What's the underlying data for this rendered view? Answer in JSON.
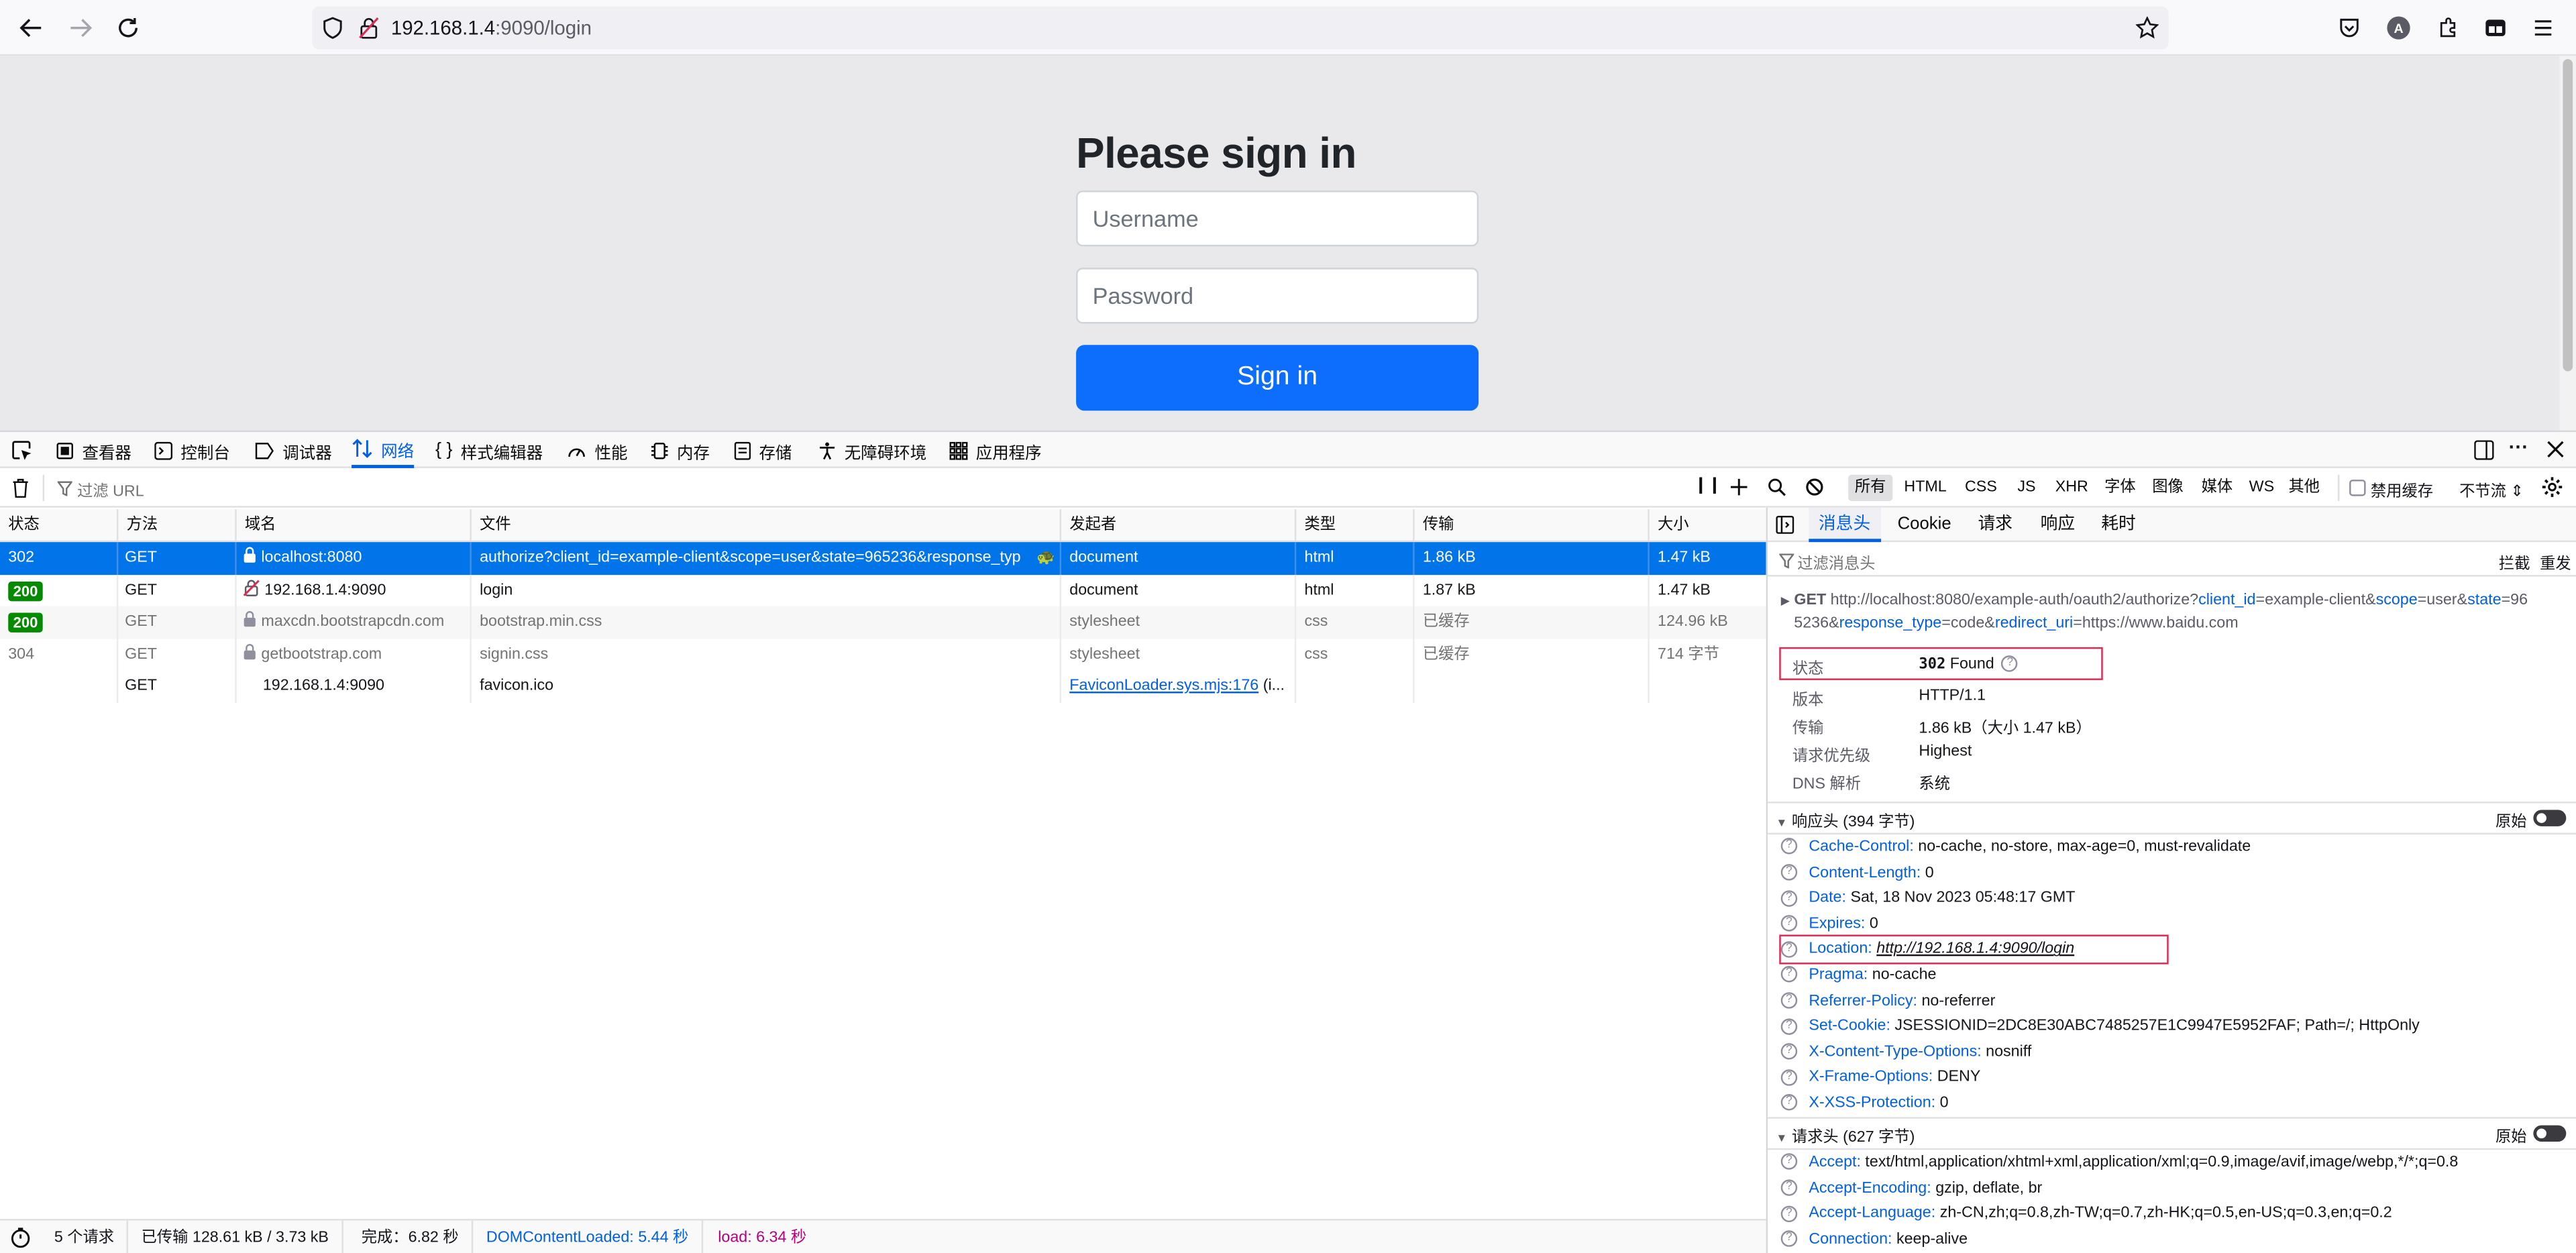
{
  "browser": {
    "url_host": "192.168.1.4",
    "url_rest": ":9090/login"
  },
  "page": {
    "title": "Please sign in",
    "username_placeholder": "Username",
    "password_placeholder": "Password",
    "signin_label": "Sign in"
  },
  "devtools": {
    "tabs": [
      "查看器",
      "控制台",
      "调试器",
      "网络",
      "样式编辑器",
      "性能",
      "内存",
      "存储",
      "无障碍环境",
      "应用程序"
    ],
    "filter_placeholder": "过滤 URL",
    "type_filters": [
      "所有",
      "HTML",
      "CSS",
      "JS",
      "XHR",
      "字体",
      "图像",
      "媒体",
      "WS",
      "其他"
    ],
    "disable_cache": "禁用缓存",
    "throttle": "不节流 ⇕",
    "columns": [
      "状态",
      "方法",
      "域名",
      "文件",
      "发起者",
      "类型",
      "传输",
      "大小"
    ],
    "requests": [
      {
        "status": "302",
        "method": "GET",
        "domain": "localhost:8080",
        "file": "authorize?client_id=example-client&scope=user&state=965236&response_typ",
        "initiator": "document",
        "type": "html",
        "transferred": "1.86 kB",
        "size": "1.47 kB"
      },
      {
        "status": "200",
        "method": "GET",
        "domain": "192.168.1.4:9090",
        "file": "login",
        "initiator": "document",
        "type": "html",
        "transferred": "1.87 kB",
        "size": "1.47 kB"
      },
      {
        "status": "200",
        "method": "GET",
        "domain": "maxcdn.bootstrapcdn.com",
        "file": "bootstrap.min.css",
        "initiator": "stylesheet",
        "type": "css",
        "transferred": "已缓存",
        "size": "124.96 kB"
      },
      {
        "status": "304",
        "method": "GET",
        "domain": "getbootstrap.com",
        "file": "signin.css",
        "initiator": "stylesheet",
        "type": "css",
        "transferred": "已缓存",
        "size": "714 字节"
      },
      {
        "status": "",
        "method": "GET",
        "domain": "192.168.1.4:9090",
        "file": "favicon.ico",
        "initiator": "FaviconLoader.sys.mjs:176",
        "initiator_suffix": " (i...",
        "type": "",
        "transferred": "",
        "size": ""
      }
    ],
    "statusbar": {
      "requests": "5 个请求",
      "transferred": "已传输 128.61 kB / 3.73 kB",
      "finish": "完成：6.82 秒",
      "dcl": "DOMContentLoaded: 5.44 秒",
      "load": "load: 6.34 秒"
    }
  },
  "side": {
    "tabs": [
      "消息头",
      "Cookie",
      "请求",
      "响应",
      "耗时"
    ],
    "filter_placeholder": "过滤消息头",
    "block": "拦截",
    "resend": "重发",
    "request_line": {
      "method": "GET",
      "base": "http://localhost:8080/example-auth/oauth2/authorize?",
      "p1k": "client_id",
      "p1v": "=example-client&",
      "p2k": "scope",
      "p2v": "=user&",
      "p3k": "state",
      "p3v": "=96",
      "l2a": "5236&",
      "p4k": "response_type",
      "p4v": "=code&",
      "p5k": "redirect_uri",
      "p5v": "=https://www.baidu.com"
    },
    "summary": [
      {
        "k": "状态",
        "v": "Found",
        "code": "302"
      },
      {
        "k": "版本",
        "v": "HTTP/1.1"
      },
      {
        "k": "传输",
        "v": "1.86 kB（大小 1.47 kB）"
      },
      {
        "k": "请求优先级",
        "v": "Highest"
      },
      {
        "k": "DNS 解析",
        "v": "系统"
      }
    ],
    "response_headers_title": "响应头 (394 字节)",
    "raw": "原始",
    "response_headers": [
      {
        "k": "Cache-Control:",
        "v": "no-cache, no-store, max-age=0, must-revalidate"
      },
      {
        "k": "Content-Length:",
        "v": "0"
      },
      {
        "k": "Date:",
        "v": "Sat, 18 Nov 2023 05:48:17 GMT"
      },
      {
        "k": "Expires:",
        "v": "0"
      },
      {
        "k": "Location:",
        "v": "http://192.168.1.4:9090/login"
      },
      {
        "k": "Pragma:",
        "v": "no-cache"
      },
      {
        "k": "Referrer-Policy:",
        "v": "no-referrer"
      },
      {
        "k": "Set-Cookie:",
        "v": "JSESSIONID=2DC8E30ABC7485257E1C9947E5952FAF; Path=/; HttpOnly"
      },
      {
        "k": "X-Content-Type-Options:",
        "v": "nosniff"
      },
      {
        "k": "X-Frame-Options:",
        "v": "DENY"
      },
      {
        "k": "X-XSS-Protection:",
        "v": "0"
      }
    ],
    "request_headers_title": "请求头 (627 字节)",
    "request_headers": [
      {
        "k": "Accept:",
        "v": "text/html,application/xhtml+xml,application/xml;q=0.9,image/avif,image/webp,*/*;q=0.8"
      },
      {
        "k": "Accept-Encoding:",
        "v": "gzip, deflate, br"
      },
      {
        "k": "Accept-Language:",
        "v": "zh-CN,zh;q=0.8,zh-TW;q=0.7,zh-HK;q=0.5,en-US;q=0.3,en;q=0.2"
      },
      {
        "k": "Connection:",
        "v": "keep-alive"
      }
    ]
  }
}
